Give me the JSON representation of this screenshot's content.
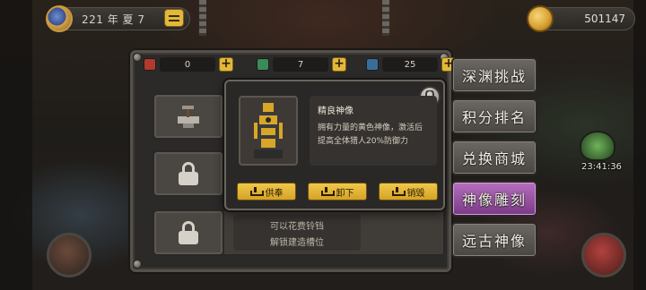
{
  "header": {
    "date": "221 年 夏 7",
    "coins": "501147"
  },
  "resources": [
    {
      "icon": "red-crystal-icon",
      "value": "0",
      "color": "#b03a2e"
    },
    {
      "icon": "green-crystal-icon",
      "value": "7",
      "color": "#3a8a5a"
    },
    {
      "icon": "blue-crystal-icon",
      "value": "25",
      "color": "#3a6e9a"
    }
  ],
  "slots": {
    "unlock_line1": "可以花费铃铛",
    "unlock_line2": "解锁建造槽位"
  },
  "popup": {
    "name": "精良神像",
    "description": "拥有力量的黄色神像，激活后提高全体猎人20%防御力",
    "buttons": [
      "供奉",
      "卸下",
      "销毁"
    ]
  },
  "side_tabs": [
    "深渊挑战",
    "积分排名",
    "兑换商城",
    "神像雕刻",
    "远古神像"
  ],
  "active_tab_index": 3,
  "timer": "23:41:36",
  "colors": {
    "accent_gold": "#e3b83a",
    "active_tab": "#9a4fa5"
  }
}
